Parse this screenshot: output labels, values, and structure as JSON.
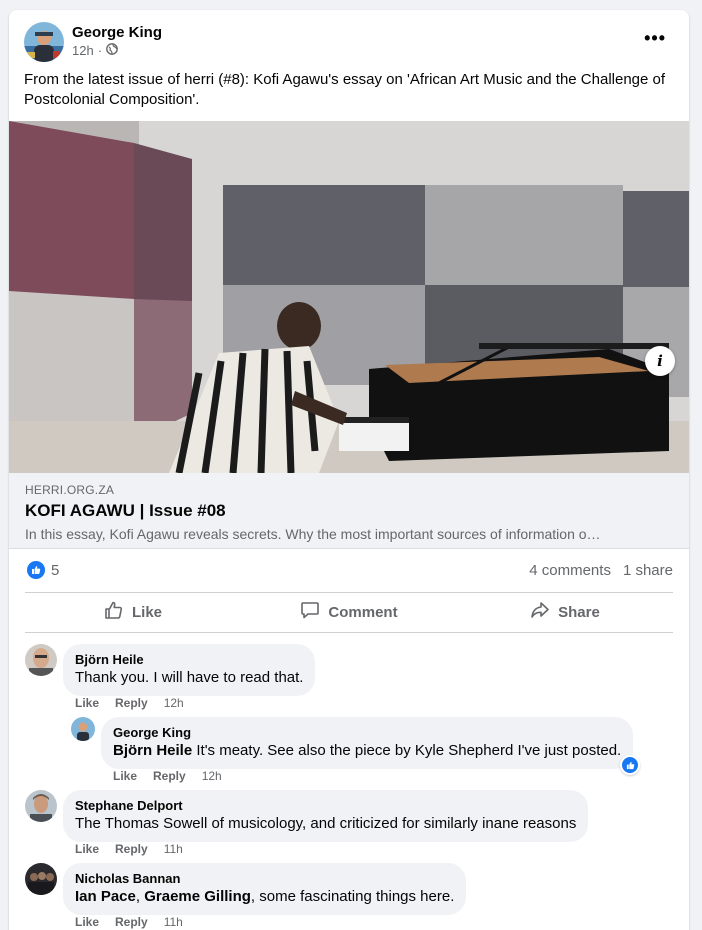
{
  "post": {
    "author": "George King",
    "time": "12h",
    "separator": "·",
    "text": "From the latest issue of herri (#8): Kofi Agawu's essay on 'African Art Music and the Challenge of Postcolonial Composition'.",
    "more_icon": "more-horizontal-icon",
    "privacy_icon": "globe-icon"
  },
  "link_preview": {
    "domain": "HERRI.ORG.ZA",
    "title": "KOFI AGAWU | Issue #08",
    "description": "In this essay, Kofi Agawu reveals secrets. Why the most important sources of information o…"
  },
  "stats": {
    "likes": "5",
    "comments": "4 comments",
    "shares": "1 share"
  },
  "actions": {
    "like": "Like",
    "comment": "Comment",
    "share": "Share"
  },
  "comments": [
    {
      "name": "Björn Heile",
      "text": "Thank you. I will have to read that.",
      "like": "Like",
      "reply": "Reply",
      "time": "12h"
    },
    {
      "name": "George King",
      "mention": "Björn Heile",
      "text": " It's meaty. See also the piece by Kyle Shepherd I've just posted.",
      "like": "Like",
      "reply": "Reply",
      "time": "12h"
    },
    {
      "name": "Stephane Delport",
      "text": "The Thomas Sowell of musicology, and criticized for similarly inane reasons",
      "like": "Like",
      "reply": "Reply",
      "time": "11h"
    },
    {
      "name": "Nicholas Bannan",
      "mention1": "Ian Pace",
      "sep": ", ",
      "mention2": "Graeme Gilling",
      "text": ", some fascinating things here.",
      "like": "Like",
      "reply": "Reply",
      "time": "11h"
    }
  ],
  "colors": {
    "accent": "#1877f2",
    "secondary_text": "#65676b",
    "bubble": "#f0f2f5"
  }
}
